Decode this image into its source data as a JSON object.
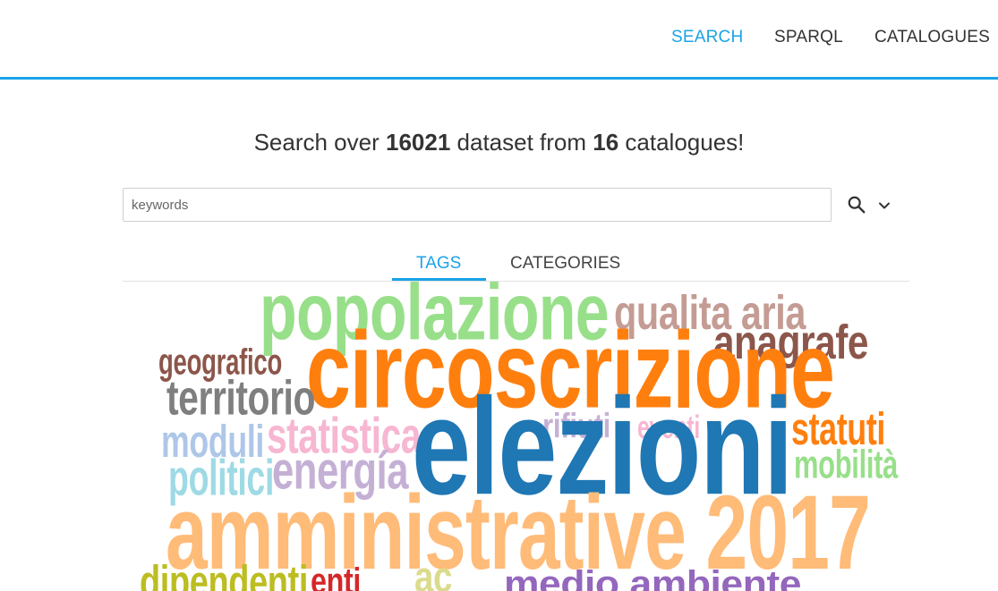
{
  "nav": {
    "items": [
      {
        "label": "SEARCH",
        "active": true
      },
      {
        "label": "SPARQL",
        "active": false
      },
      {
        "label": "CATALOGUES",
        "active": false
      }
    ]
  },
  "headline": {
    "prefix": "Search over ",
    "dataset_count": "16021",
    "middle": " dataset from ",
    "catalogue_count": "16",
    "suffix": " catalogues!"
  },
  "search": {
    "placeholder": "keywords",
    "value": "",
    "search_icon": "search-icon",
    "expand_icon": "chevron-down-icon"
  },
  "tabs": [
    {
      "label": "TAGS",
      "active": true
    },
    {
      "label": "CATEGORIES",
      "active": false
    }
  ],
  "tag_cloud": {
    "words": [
      {
        "text": "popolazione",
        "color": "#98df8a"
      },
      {
        "text": "qualita aria",
        "color": "#c49c94"
      },
      {
        "text": "anagrafe",
        "color": "#8c564b"
      },
      {
        "text": "geografico",
        "color": "#8c564b"
      },
      {
        "text": "circoscrizione",
        "color": "#ff7f0e"
      },
      {
        "text": "territorio",
        "color": "#7f7f7f"
      },
      {
        "text": "rifiuti",
        "color": "#c5b0d5"
      },
      {
        "text": "eventi",
        "color": "#f7b6d2"
      },
      {
        "text": "statuti",
        "color": "#ff7f0e"
      },
      {
        "text": "moduli",
        "color": "#aec7e8"
      },
      {
        "text": "statistica",
        "color": "#f7b6d2"
      },
      {
        "text": "elezioni",
        "color": "#1f77b4"
      },
      {
        "text": "mobilità",
        "color": "#98df8a"
      },
      {
        "text": "politici",
        "color": "#9edae5"
      },
      {
        "text": "energía",
        "color": "#c5b0d5"
      },
      {
        "text": "amministrative 2017",
        "color": "#ffbb78"
      },
      {
        "text": "dipendenti",
        "color": "#bcbd22"
      },
      {
        "text": "enti",
        "color": "#d62728"
      },
      {
        "text": "ac",
        "color": "#dbdb8d"
      },
      {
        "text": "medio ambiente",
        "color": "#9467bd"
      }
    ]
  }
}
